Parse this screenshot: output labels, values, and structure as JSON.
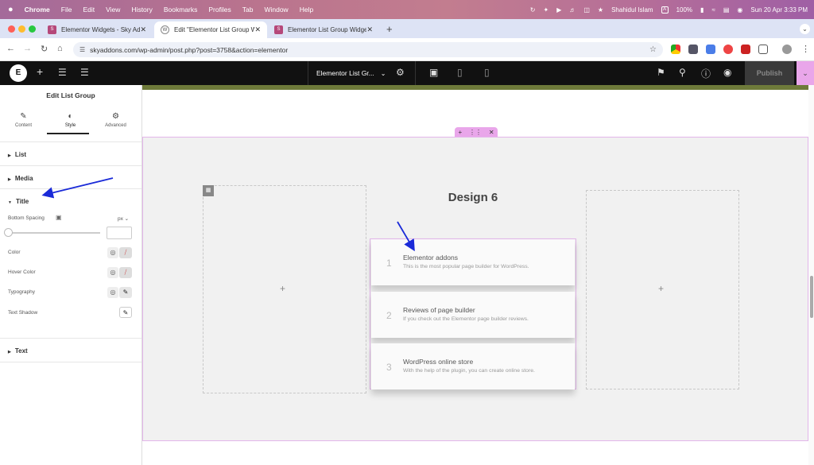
{
  "menubar": {
    "apple": "",
    "app": "Chrome",
    "items": [
      "File",
      "Edit",
      "View",
      "History",
      "Bookmarks",
      "Profiles",
      "Tab",
      "Window",
      "Help"
    ],
    "user": "Shahidul Islam",
    "input_badge": "A",
    "battery": "100%",
    "datetime": "Sun 20 Apr  3:33 PM"
  },
  "tabs": [
    {
      "title": "Elementor Widgets - Sky Add",
      "close": "✕"
    },
    {
      "title": "Edit \"Elementor List Group W",
      "close": "✕"
    },
    {
      "title": "Elementor List Group Widget",
      "close": "✕"
    }
  ],
  "new_tab": "+",
  "address": {
    "url": "skyaddons.com/wp-admin/post.php?post=3758&action=elementor"
  },
  "editor": {
    "document_title": "Elementor List Gr...",
    "publish_label": "Publish"
  },
  "panel": {
    "title": "Edit List Group",
    "tabs": [
      {
        "label": "Content",
        "icon": "pencil-icon"
      },
      {
        "label": "Style",
        "icon": "half-circle-icon"
      },
      {
        "label": "Advanced",
        "icon": "gear-icon"
      }
    ],
    "sections": {
      "list": "List",
      "media": "Media",
      "title": "Title",
      "text": "Text"
    },
    "controls": {
      "bottom_spacing": "Bottom Spacing",
      "unit": "px",
      "bottom_spacing_value": "",
      "color": "Color",
      "hover_color": "Hover Color",
      "typography": "Typography",
      "text_shadow": "Text Shadow"
    }
  },
  "canvas": {
    "heading": "Design 6",
    "items": [
      {
        "num": "1",
        "title": "Elementor addons",
        "desc": "This is the most popular page builder for WordPress."
      },
      {
        "num": "2",
        "title": "Reviews of page builder",
        "desc": "If you check out the Elementor page builder reviews."
      },
      {
        "num": "3",
        "title": "WordPress online store",
        "desc": "With the help of the plugin, you can create online store."
      }
    ]
  },
  "colors": {
    "accent_pink": "#e9a6ea",
    "annotation_arrow": "#1a2ad8",
    "toolbar_bg": "#111111"
  }
}
